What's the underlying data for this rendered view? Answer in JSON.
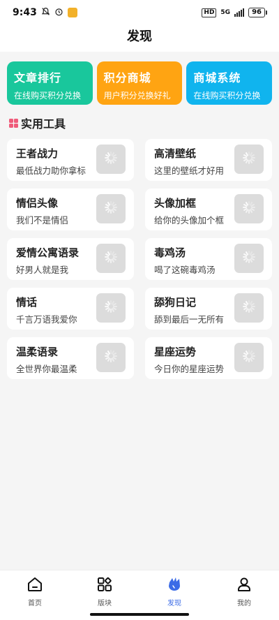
{
  "status": {
    "time": "9:43",
    "network": "5G",
    "hd": "HD",
    "battery": "96"
  },
  "header": {
    "title": "发现"
  },
  "banners": [
    {
      "title": "文章排行",
      "subtitle": "在线购买积分兑换",
      "color": "#19c79c"
    },
    {
      "title": "积分商城",
      "subtitle": "用户积分兑换好礼",
      "color": "#ffa412"
    },
    {
      "title": "商城系统",
      "subtitle": "在线购买积分兑换",
      "color": "#10b4ee"
    }
  ],
  "section": {
    "title": "实用工具"
  },
  "tools": [
    {
      "title": "王者战力",
      "subtitle": "最低战力助你拿标"
    },
    {
      "title": "高清壁纸",
      "subtitle": "这里的壁纸才好用"
    },
    {
      "title": "情侣头像",
      "subtitle": "我们不是情侣"
    },
    {
      "title": "头像加框",
      "subtitle": "给你的头像加个框"
    },
    {
      "title": "爱情公寓语录",
      "subtitle": "好男人就是我"
    },
    {
      "title": "毒鸡汤",
      "subtitle": "喝了这碗毒鸡汤"
    },
    {
      "title": "情话",
      "subtitle": "千言万语我爱你"
    },
    {
      "title": "舔狗日记",
      "subtitle": "舔到最后一无所有"
    },
    {
      "title": "温柔语录",
      "subtitle": "全世界你最温柔"
    },
    {
      "title": "星座运势",
      "subtitle": "今日你的星座运势"
    }
  ],
  "tabbar": {
    "items": [
      {
        "label": "首页",
        "icon": "home-icon"
      },
      {
        "label": "版块",
        "icon": "blocks-icon"
      },
      {
        "label": "发现",
        "icon": "discover-icon",
        "active": true
      },
      {
        "label": "我的",
        "icon": "profile-icon"
      }
    ],
    "active_color": "#3b6be6"
  }
}
